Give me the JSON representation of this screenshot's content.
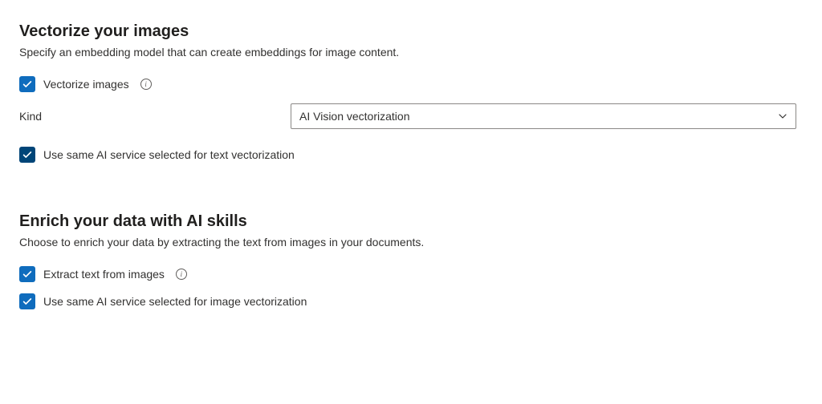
{
  "vectorize": {
    "title": "Vectorize your images",
    "desc": "Specify an embedding model that can create embeddings for image content.",
    "checkbox1_label": "Vectorize images",
    "kind_label": "Kind",
    "kind_value": "AI Vision vectorization",
    "checkbox2_label": "Use same AI service selected for text vectorization"
  },
  "enrich": {
    "title": "Enrich your data with AI skills",
    "desc": "Choose to enrich your data by extracting the text from images in your documents.",
    "checkbox1_label": "Extract text from images",
    "checkbox2_label": "Use same AI service selected for image vectorization"
  }
}
